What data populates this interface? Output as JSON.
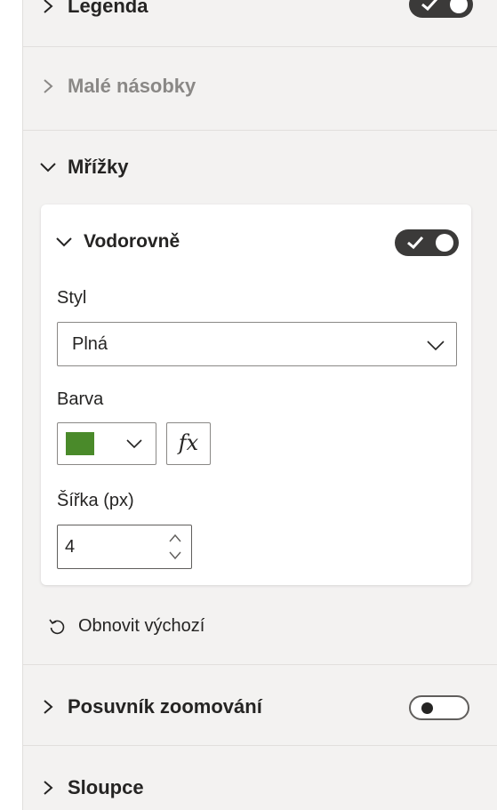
{
  "sections": {
    "legend": {
      "label": "Legenda",
      "toggle": "on"
    },
    "small_multiples": {
      "label": "Malé násobky"
    },
    "gridlines": {
      "label": "Mřížky"
    },
    "zoom_slider": {
      "label": "Posuvník zoomování",
      "toggle": "off"
    },
    "columns": {
      "label": "Sloupce"
    }
  },
  "horizontal": {
    "label": "Vodorovně",
    "toggle": "on",
    "style_label": "Styl",
    "style_value": "Plná",
    "color_label": "Barva",
    "color_value": "#4a8a2a",
    "fx_label": "fx",
    "width_label": "Šířka (px)",
    "width_value": "4"
  },
  "reset_label": "Obnovit výchozí",
  "icons": {
    "collapsed": "chevron-right-icon",
    "expanded": "chevron-down-icon",
    "dropdown": "chevron-down-icon",
    "reset": "reset-icon",
    "stepper_up": "chevron-up-icon",
    "stepper_down": "chevron-down-icon"
  }
}
